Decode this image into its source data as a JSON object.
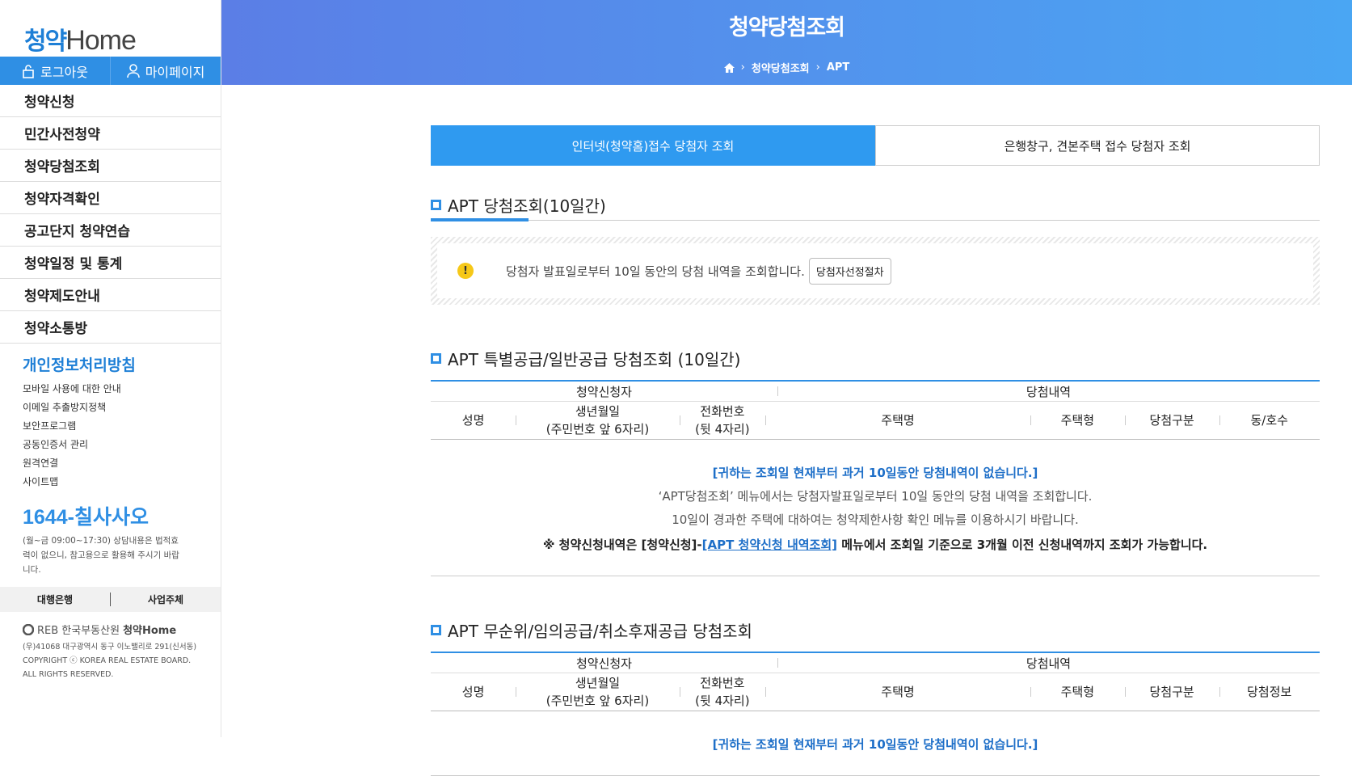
{
  "sidebar": {
    "logo_korean": "청약",
    "logo_home": "Home",
    "logout": "로그아웃",
    "mypage": "마이페이지",
    "menu": [
      "청약신청",
      "민간사전청약",
      "청약당첨조회",
      "청약자격확인",
      "공고단지 청약연습",
      "청약일정 및 통계",
      "청약제도안내",
      "청약소통방"
    ],
    "privacy": "개인정보처리방침",
    "links": [
      "모바일 사용에 대한 안내",
      "이메일 추출방지정책",
      "보안프로그램",
      "공동인증서 관리",
      "원격연결",
      "사이트맵"
    ],
    "phone": "1644-칠사사오",
    "phone_note": "(월~금 09:00~17:30) 상담내용은 법적효력이 없으니, 참고용으로 활용해 주시기 바랍니다.",
    "bank": "대행은행",
    "operator": "사업주체",
    "footer_logo": "REB 한국부동산원",
    "footer_logo2": "청약Home",
    "address": "(우)41068 대구광역시 동구 이노밸리로 291(신서동)",
    "copyright1": "COPYRIGHT ⓒ KOREA REAL ESTATE BOARD.",
    "copyright2": "ALL RIGHTS RESERVED."
  },
  "header": {
    "title": "청약당첨조회",
    "crumb1": "청약당첨조회",
    "crumb2": "APT"
  },
  "tabs": {
    "active": "인터넷(청약홈)접수 당첨자 조회",
    "other": "은행창구, 견본주택 접수 당첨자 조회"
  },
  "section1": {
    "title": "APT 당첨조회(10일간)",
    "notice": "당첨자 발표일로부터 10일 동안의 당첨 내역을 조회합니다.",
    "button": "당첨자선정절차"
  },
  "table_headers": {
    "applicant": "청약신청자",
    "result": "당첨내역",
    "name": "성명",
    "birth": "생년월일",
    "birth_sub": "(주민번호 앞 6자리)",
    "phone": "전화번호",
    "phone_sub": "(뒷 4자리)",
    "house": "주택명",
    "type": "주택형",
    "category": "당첨구분",
    "unit": "동/호수",
    "info": "당첨정보"
  },
  "section2": {
    "title": "APT 특별공급/일반공급 당첨조회 (10일간)",
    "empty_blue": "[귀하는 조회일 현재부터 과거 10일동안 당첨내역이 없습니다.]",
    "empty_g1": "‘APT당첨조회’ 메뉴에서는 당첨자발표일로부터 10일 동안의 당첨 내역을 조회합니다.",
    "empty_g2": "10일이 경과한 주택에 대하여는 청약제한사항 확인 메뉴를 이용하시기 바랍니다.",
    "note_pre": "※ 청약신청내역은 [청약신청]-",
    "note_link": "[APT 청약신청 내역조회]",
    "note_post": " 메뉴에서 조회일 기준으로 3개월 이전 신청내역까지 조회가 가능합니다."
  },
  "section3": {
    "title": "APT 무순위/임의공급/취소후재공급 당첨조회",
    "empty_blue": "[귀하는 조회일 현재부터 과거 10일동안 당첨내역이 없습니다.]"
  }
}
